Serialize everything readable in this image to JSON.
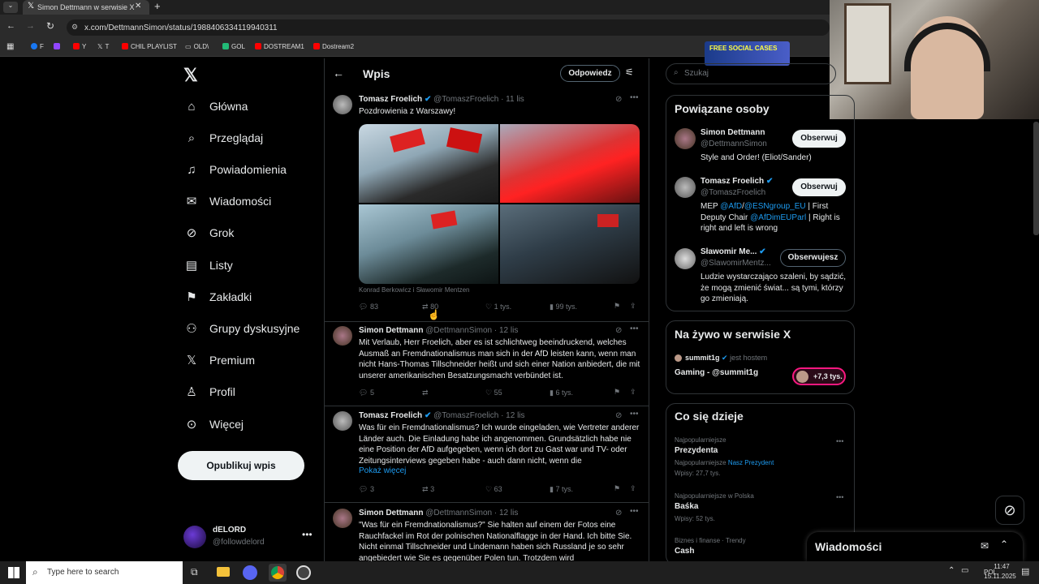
{
  "browser": {
    "tab_title": "Simon Dettmann w serwisie X",
    "url": "x.com/DettmannSimon/status/1988406334119940311",
    "bookmarks": [
      "F",
      "",
      "Y",
      "T",
      "CHIL PLAYLIST",
      "OLD\\",
      "GOL",
      "DOSTREAM1",
      "Dostream2"
    ]
  },
  "nav": {
    "items": [
      {
        "label": "Główna",
        "icon": "home-icon"
      },
      {
        "label": "Przeglądaj",
        "icon": "search-icon"
      },
      {
        "label": "Powiadomienia",
        "icon": "bell-icon"
      },
      {
        "label": "Wiadomości",
        "icon": "mail-icon"
      },
      {
        "label": "Grok",
        "icon": "grok-icon"
      },
      {
        "label": "Listy",
        "icon": "list-icon"
      },
      {
        "label": "Zakładki",
        "icon": "bookmark-icon"
      },
      {
        "label": "Grupy dyskusyjne",
        "icon": "people-icon"
      },
      {
        "label": "Premium",
        "icon": "x-icon"
      },
      {
        "label": "Profil",
        "icon": "person-icon"
      },
      {
        "label": "Więcej",
        "icon": "more-icon"
      }
    ],
    "post_button": "Opublikuj wpis",
    "user": {
      "name": "dELORD",
      "handle": "@followdelord"
    }
  },
  "header": {
    "title": "Wpis",
    "reply_button": "Odpowiedz"
  },
  "main_tweet": {
    "name": "Tomasz Froelich",
    "handle": "@TomaszFroelich",
    "time": "· 11 lis",
    "text": "Pozdrowienia z Warszawy!",
    "caption": "Konrad Berkowicz i Sławomir Mentzen",
    "replies": "83",
    "retweets": "80",
    "likes": "1 tys.",
    "views": "99 tys."
  },
  "tweets": [
    {
      "name": "Simon Dettmann",
      "handle": "@DettmannSimon",
      "time": "· 12 lis",
      "text": "Mit Verlaub, Herr Froelich, aber es ist schlichtweg beeindruckend, welches Ausmaß an Fremdnationalismus man sich in der AfD leisten kann, wenn man nicht Hans-Thomas Tillschneider heißt und sich einer Nation anbiedert, die mit unserer amerikanischen Besatzungsmacht verbündet ist.",
      "replies": "5",
      "retweets": "",
      "likes": "55",
      "views": "6 tys."
    },
    {
      "name": "Tomasz Froelich",
      "handle": "@TomaszFroelich",
      "time": "· 12 lis",
      "text": "Was für ein Fremdnationalismus? Ich wurde eingeladen, wie Vertreter anderer Länder auch. Die Einladung habe ich angenommen. Grundsätzlich habe nie eine Position der AfD aufgegeben, wenn ich dort zu Gast war und TV- oder Zeitungsinterviews gegeben habe  - auch dann nicht, wenn die",
      "more": "Pokaż więcej",
      "replies": "3",
      "retweets": "3",
      "likes": "63",
      "views": "7 tys."
    },
    {
      "name": "Simon Dettmann",
      "handle": "@DettmannSimon",
      "time": "· 12 lis",
      "text": "\"Was für ein Fremdnationalismus?\" Sie halten auf einem der Fotos eine Rauchfackel im Rot der polnischen Nationalflagge in der Hand. Ich bitte Sie. Nicht einmal Tillschneider und Lindemann haben sich Russland je so sehr angebiedert wie Sie es gegenüber Polen tun. Trotzdem wird"
    }
  ],
  "search": {
    "placeholder": "Szukaj"
  },
  "related": {
    "title": "Powiązane osoby",
    "people": [
      {
        "name": "Simon Dettmann",
        "handle": "@DettmannSimon",
        "bio": "Style and Order! (Eliot/Sander)",
        "button": "Obserwuj"
      },
      {
        "name": "Tomasz Froelich",
        "handle": "@TomaszFroelich",
        "bio_pre": "MEP ",
        "bio_l1": "@AfD",
        "bio_s1": "/",
        "bio_l2": "@ESNgroup_EU",
        "bio_s2": " | First Deputy Chair ",
        "bio_l3": "@AfDimEUParl",
        "bio_s3": " | Right is right and left is wrong",
        "button": "Obserwuj"
      },
      {
        "name": "Sławomir Me...",
        "handle": "@SlawomirMentz...",
        "bio": "Ludzie wystarczająco szaleni, by sądzić, że mogą zmienić świat... są tymi, którzy go zmieniają.",
        "button": "Obserwujesz"
      }
    ]
  },
  "live": {
    "title": "Na żywo w serwisie X",
    "host": "summit1g",
    "host_suffix": "jest hostem",
    "topic": "Gaming - @summit1g",
    "count": "+7,3 tys."
  },
  "trending": {
    "title": "Co się dzieje",
    "items": [
      {
        "meta": "Najpopularniejsze",
        "name": "Prezydenta",
        "sub_pre": "Najpopularniejsze",
        "sub_link": "Nasz Prezydent",
        "count": "Wpisy: 27,7 tys."
      },
      {
        "meta": "Najpopularniejsze w Polska",
        "name": "Baśka",
        "count": "Wpisy: 52 tys."
      },
      {
        "meta": "Biznes i finanse · Trendy",
        "name": "Cash"
      }
    ]
  },
  "messages": {
    "title": "Wiadomości"
  },
  "ad_text": "FREE SOCIAL CASES",
  "taskbar": {
    "search_placeholder": "Type here to search",
    "lang": "POL",
    "time": "11:47",
    "date": "15.11.2025"
  }
}
